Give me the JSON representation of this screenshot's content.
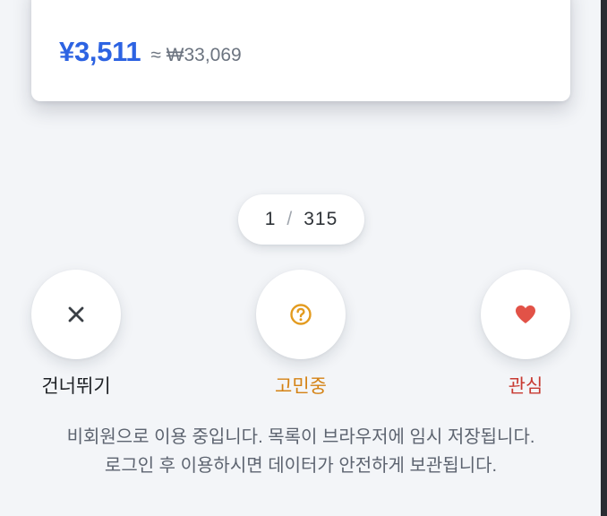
{
  "product": {
    "price": "¥3,511",
    "approx_price": "≈ ₩33,069"
  },
  "pagination": {
    "current": "1",
    "separator": "/",
    "total": "315"
  },
  "actions": [
    {
      "label": "건너뛰기",
      "icon": "close-icon",
      "color": "#3a3f45"
    },
    {
      "label": "고민중",
      "icon": "question-circle-icon",
      "color": "#e39b1f"
    },
    {
      "label": "관심",
      "icon": "heart-icon",
      "color": "#e25247"
    }
  ],
  "notice": {
    "line1": "비회원으로 이용 중입니다. 목록이 브라우저에 임시 저장됩니다.",
    "line2": "로그인 후 이용하시면 데이터가 안전하게 보관됩니다."
  },
  "colors": {
    "accent": "#2d63e2",
    "background": "#f3f5f8"
  }
}
